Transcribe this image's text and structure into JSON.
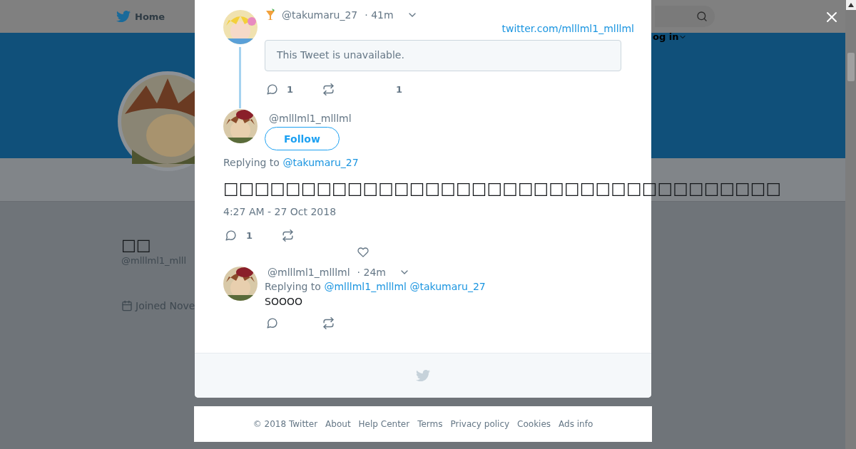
{
  "nav": {
    "home": "Home",
    "login": "og in"
  },
  "profile": {
    "name": "□□",
    "handle": "@mlllml1_mlll",
    "joined": "Joined Nove"
  },
  "parent_tweet": {
    "handle": "@takumaru_27",
    "time": "· 41m",
    "link": "twitter.com/mlllml1_mlllml",
    "quote": "This Tweet is unavailable.",
    "reply_count": "1",
    "like_count": "1"
  },
  "main_tweet": {
    "handle": "@mlllml1_mlllml",
    "follow": "Follow",
    "replying_label": "Replying to",
    "replying_to": [
      "@takumaru_27"
    ],
    "text": "□□□□□□□□□□□□□□□□□□□□□□□□□□□□□□□□□□□□",
    "timestamp": "4:27 AM - 27 Oct 2018",
    "reply_count": "1"
  },
  "reply": {
    "handle": "@mlllml1_mlllml",
    "time": "· 24m",
    "replying_label": "Replying to",
    "replying_to": [
      "@mlllml1_mlllml",
      "@takumaru_27"
    ],
    "text": "SOOOO"
  },
  "footer": [
    "© 2018 Twitter",
    "About",
    "Help Center",
    "Terms",
    "Privacy policy",
    "Cookies",
    "Ads info"
  ]
}
